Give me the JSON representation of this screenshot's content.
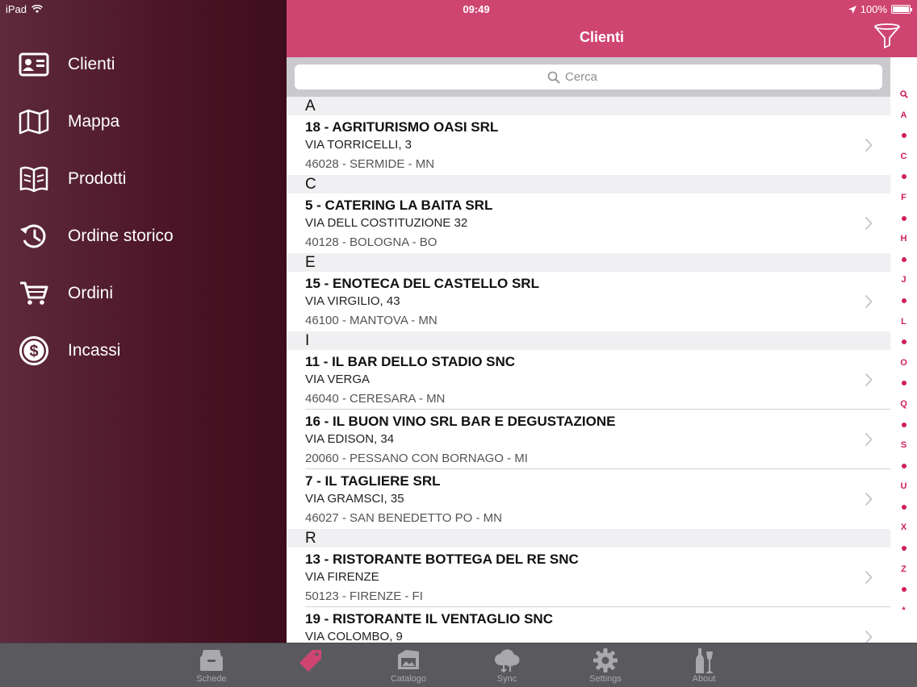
{
  "status": {
    "device": "iPad",
    "time": "09:49",
    "battery": "100%",
    "battery_level": 1.0
  },
  "sidebar": {
    "items": [
      {
        "label": "Clienti",
        "icon": "contact-card-icon"
      },
      {
        "label": "Mappa",
        "icon": "map-icon"
      },
      {
        "label": "Prodotti",
        "icon": "catalog-book-icon"
      },
      {
        "label": "Ordine storico",
        "icon": "history-icon"
      },
      {
        "label": "Ordini",
        "icon": "cart-icon"
      },
      {
        "label": "Incassi",
        "icon": "dollar-coin-icon"
      }
    ]
  },
  "header": {
    "title": "Clienti",
    "filter_icon": "filter-funnel-icon"
  },
  "search": {
    "placeholder": "Cerca",
    "value": ""
  },
  "list": {
    "sections": [
      {
        "letter": "A",
        "rows": [
          {
            "name": "18 - AGRITURISMO OASI  SRL",
            "address": "VIA TORRICELLI, 3",
            "city": "46028 - SERMIDE - MN"
          }
        ]
      },
      {
        "letter": "C",
        "rows": [
          {
            "name": "5 - CATERING LA BAITA SRL",
            "address": "VIA DELL COSTITUZIONE 32",
            "city": "40128 - BOLOGNA - BO"
          }
        ]
      },
      {
        "letter": "E",
        "rows": [
          {
            "name": "15 - ENOTECA DEL CASTELLO SRL",
            "address": "VIA VIRGILIO, 43",
            "city": "46100 - MANTOVA - MN"
          }
        ]
      },
      {
        "letter": "I",
        "rows": [
          {
            "name": "11 - IL BAR DELLO STADIO SNC",
            "address": "VIA VERGA",
            "city": "46040 - CERESARA - MN"
          },
          {
            "name": "16 - IL BUON VINO SRL BAR E DEGUSTAZIONE",
            "address": "VIA EDISON, 34",
            "city": "20060 - PESSANO CON BORNAGO - MI"
          },
          {
            "name": "7 - IL TAGLIERE SRL",
            "address": "VIA GRAMSCI, 35",
            "city": "46027 - SAN BENEDETTO PO - MN"
          }
        ]
      },
      {
        "letter": "R",
        "rows": [
          {
            "name": "13 - RISTORANTE BOTTEGA DEL RE SNC",
            "address": "VIA FIRENZE",
            "city": "50123 - FIRENZE - FI"
          },
          {
            "name": "19 - RISTORANTE IL VENTAGLIO SNC",
            "address": "VIA COLOMBO, 9",
            "city": ""
          }
        ]
      }
    ]
  },
  "index": [
    "search",
    "A",
    "•",
    "C",
    "•",
    "F",
    "•",
    "H",
    "•",
    "J",
    "•",
    "L",
    "•",
    "O",
    "•",
    "Q",
    "•",
    "S",
    "•",
    "U",
    "•",
    "X",
    "•",
    "Z",
    "•",
    "*"
  ],
  "tabbar": {
    "tabs": [
      {
        "label": "Schede",
        "icon": "card-box-icon",
        "active": false
      },
      {
        "label": "",
        "icon": "tag-icon",
        "active": true
      },
      {
        "label": "Catalogo",
        "icon": "catalog-icon",
        "active": false
      },
      {
        "label": "Sync",
        "icon": "cloud-sync-icon",
        "active": false
      },
      {
        "label": "Settings",
        "icon": "gear-icon",
        "active": false
      },
      {
        "label": "About",
        "icon": "bottles-icon",
        "active": false
      }
    ]
  },
  "colors": {
    "accent": "#cf4571",
    "index": "#cf1f5b",
    "sidebar": "#4b1526"
  }
}
